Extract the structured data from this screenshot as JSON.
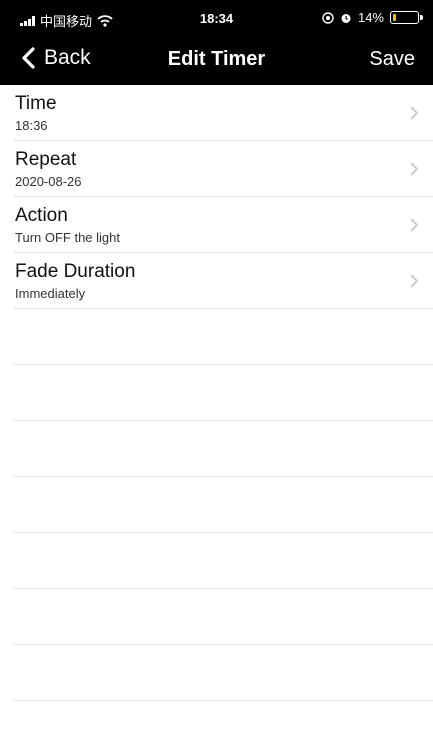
{
  "status_bar": {
    "carrier": "中国移动",
    "time": "18:34",
    "battery": "14%",
    "battery_level": 0.14,
    "battery_color": "#f2c200",
    "icons": [
      "signal-icon",
      "wifi-icon",
      "location-icon",
      "alarm-icon",
      "battery-icon"
    ]
  },
  "nav": {
    "back_label": "Back",
    "title": "Edit Timer",
    "save_label": "Save"
  },
  "rows": [
    {
      "label": "Time",
      "value": "18:36"
    },
    {
      "label": "Repeat",
      "value": "2020-08-26"
    },
    {
      "label": "Action",
      "value": "Turn OFF the light"
    },
    {
      "label": "Fade Duration",
      "value": "Immediately"
    }
  ],
  "colors": {
    "header_bg": "#000000",
    "divider": "#e3e3e3",
    "chevron": "#c7c7cc"
  }
}
